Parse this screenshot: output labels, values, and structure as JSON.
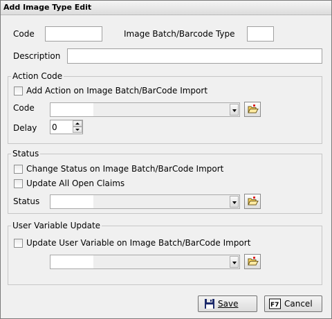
{
  "window": {
    "title": "Add Image Type Edit"
  },
  "fields": {
    "code_label": "Code",
    "code_value": "",
    "batch_type_label": "Image Batch/Barcode Type",
    "batch_type_value": "",
    "description_label": "Description",
    "description_value": ""
  },
  "action_code": {
    "legend": "Action Code",
    "checkbox_label": "Add Action on Image Batch/BarCode Import",
    "checked": false,
    "code_label": "Code",
    "code_value": "",
    "delay_label": "Delay",
    "delay_value": "0"
  },
  "status": {
    "legend": "Status",
    "change_status_label": "Change Status on Image Batch/BarCode Import",
    "change_status_checked": false,
    "update_open_claims_label": "Update All Open Claims",
    "update_open_claims_checked": false,
    "status_label": "Status",
    "status_value": ""
  },
  "user_variable": {
    "legend": "User Variable Update",
    "checkbox_label": "Update User Variable on Image Batch/BarCode Import",
    "checked": false,
    "value": ""
  },
  "buttons": {
    "save_label": "Save",
    "save_icon": "floppy-disk-icon",
    "cancel_label": "Cancel",
    "cancel_icon": "f7-key-icon",
    "browse_icon": "folder-open-icon"
  }
}
